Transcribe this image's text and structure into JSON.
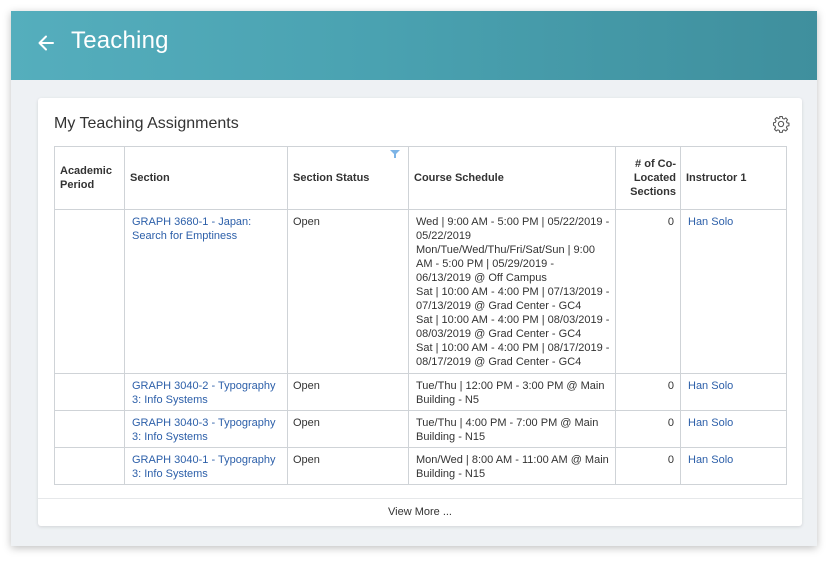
{
  "header": {
    "title": "Teaching"
  },
  "card": {
    "title": "My Teaching Assignments",
    "view_more": "View More ..."
  },
  "table": {
    "columns": [
      "Academic Period",
      "Section",
      "Section Status",
      "Course Schedule",
      "# of Co-Located Sections",
      "Instructor 1"
    ],
    "rows": [
      {
        "academic_period": "",
        "section": "GRAPH 3680-1 - Japan: Search for Emptiness",
        "status": "Open",
        "schedule": [
          "Wed | 9:00 AM - 5:00 PM | 05/22/2019 - 05/22/2019",
          "Mon/Tue/Wed/Thu/Fri/Sat/Sun | 9:00 AM - 5:00 PM | 05/29/2019 - 06/13/2019 @ Off Campus",
          "Sat | 10:00 AM - 4:00 PM | 07/13/2019 - 07/13/2019 @ Grad Center - GC4",
          "Sat | 10:00 AM - 4:00 PM | 08/03/2019 - 08/03/2019 @ Grad Center - GC4",
          "Sat | 10:00 AM - 4:00 PM | 08/17/2019 - 08/17/2019 @ Grad Center - GC4"
        ],
        "co_located": "0",
        "instructor": "Han Solo"
      },
      {
        "academic_period": "",
        "section": "GRAPH 3040-2 - Typography 3: Info Systems",
        "status": "Open",
        "schedule": [
          "Tue/Thu | 12:00 PM - 3:00 PM @ Main Building - N5"
        ],
        "co_located": "0",
        "instructor": "Han Solo"
      },
      {
        "academic_period": "",
        "section": "GRAPH 3040-3 - Typography 3: Info Systems",
        "status": "Open",
        "schedule": [
          "Tue/Thu | 4:00 PM - 7:00 PM @ Main Building - N15"
        ],
        "co_located": "0",
        "instructor": "Han Solo"
      },
      {
        "academic_period": "",
        "section": "GRAPH 3040-1 - Typography 3: Info Systems",
        "status": "Open",
        "schedule": [
          "Mon/Wed | 8:00 AM - 11:00 AM @ Main Building - N15"
        ],
        "co_located": "0",
        "instructor": "Han Solo"
      }
    ]
  },
  "icons": {
    "back": "arrow-left-icon",
    "settings": "gear-icon",
    "filter": "filter-icon"
  },
  "colors": {
    "header_start": "#55aebd",
    "header_end": "#3f8f9d",
    "link": "#2c5fa9",
    "filter": "#7db4e6"
  }
}
